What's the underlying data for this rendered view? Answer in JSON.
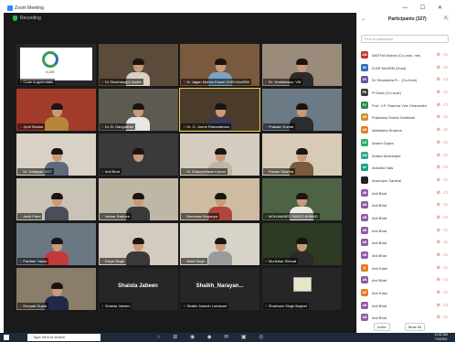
{
  "window": {
    "title": "Zoom Meeting",
    "controls": "— ☐ ✕"
  },
  "meeting": {
    "label": "Recording",
    "view_label": "Speaker View"
  },
  "tiles": [
    {
      "name": "Code Augmentatio",
      "kind": "logo",
      "logo_text": "ICAR"
    },
    {
      "name": "Dr Shubhangini Jantre",
      "kind": "person",
      "bg": "#5b4b3a",
      "shirt": "#d7d0c4"
    },
    {
      "name": "Dr Jagan Mohan Kosuri ICAR-NAARM",
      "kind": "person",
      "bg": "#7a5a3e",
      "shirt": "#7aa4c8"
    },
    {
      "name": "Dr. Venkatesan, VM",
      "kind": "person",
      "bg": "#9a8b7a",
      "shirt": "#2a2a2a"
    },
    {
      "name": "Jyoti Sankar",
      "kind": "person",
      "bg": "#a33b2b",
      "shirt": "#b7863b"
    },
    {
      "name": "Dr. B. Gangadhar",
      "kind": "person",
      "bg": "#5e5a52",
      "shirt": "#e6e6e6"
    },
    {
      "name": "Dr. G. Jonne Ramaratnam",
      "kind": "person",
      "bg": "#4b3b2a",
      "shirt": "#3a3a55",
      "highlight": true
    },
    {
      "name": "Prakash Kumar",
      "kind": "person",
      "bg": "#6c7a86",
      "shirt": "#2c2c2c"
    },
    {
      "name": "Dr. Dattayak VGT",
      "kind": "person",
      "bg": "#d8d2c6",
      "shirt": "#5b6b7a"
    },
    {
      "name": "Anil Bhat",
      "kind": "person",
      "bg": "#3a3a3a",
      "shirt": "#3a3a3a"
    },
    {
      "name": "Dr Dhanyeshwar Kumar",
      "kind": "person",
      "bg": "#d4cdbf",
      "shirt": "#bfb6a4"
    },
    {
      "name": "Pawan Sharma",
      "kind": "person",
      "bg": "#d7cbb8",
      "shirt": "#7b5a3d"
    },
    {
      "name": "Ankit Patel",
      "kind": "person",
      "bg": "#c9c3b6",
      "shirt": "#4a4e5a"
    },
    {
      "name": "Ishwar Rathore",
      "kind": "person",
      "bg": "#bfb7a6",
      "shirt": "#3a3a3a"
    },
    {
      "name": "Nimmala Soujanya",
      "kind": "person",
      "bg": "#cdbba2",
      "shirt": "#b0463f"
    },
    {
      "name": "MOHAMMED SAROJ AHMAD",
      "kind": "person",
      "bg": "#4e6246",
      "shirt": "#ece9e4"
    },
    {
      "name": "Parthan Yadav",
      "kind": "person",
      "bg": "#6b7884",
      "shirt": "#c33a3a"
    },
    {
      "name": "Divya Singh",
      "kind": "person",
      "bg": "#d4cbc0",
      "shirt": "#3a3a3a"
    },
    {
      "name": "Ankit Singh",
      "kind": "person",
      "bg": "#d8d3c8",
      "shirt": "#9a9a9a"
    },
    {
      "name": "Murlidhar Shirsat",
      "kind": "person",
      "bg": "#2f3a25",
      "shirt": "#2a2a2a"
    },
    {
      "name": "Deepak Gupta",
      "kind": "person",
      "bg": "#8a7d6a",
      "shirt": "#1f2a4a"
    },
    {
      "name": "Shaista Jabeen",
      "kind": "text",
      "big": "Shaista Jabeen"
    },
    {
      "name": "Shaikh Naresh Lohakare",
      "kind": "text",
      "big": "Shaikh_Narayan..."
    },
    {
      "name": "Shubham Singh Baghel",
      "kind": "image"
    }
  ],
  "participants": {
    "title": "Participants (327)",
    "search_placeholder": "Find a participant",
    "items": [
      {
        "initials": "AM",
        "name": "ANITHA Mohan (Co-host, me)",
        "color": "#c0392b"
      },
      {
        "initials": "IM",
        "name": "ICAR NAARM (Host)",
        "color": "#2d6fb7"
      },
      {
        "initials": "DS",
        "name": "Dr Srivastava R... (Co-host)",
        "color": "#6b4fa0"
      },
      {
        "initials": "PD",
        "name": "Pi Dash (Co-host)",
        "color": "#3a3a3a"
      },
      {
        "initials": "PJ",
        "name": "Prof. J.P. Sharma Vice Chancellor",
        "color": "#2c8a4a"
      },
      {
        "initials": "AS",
        "name": "Prakasha Sneha Gudibadi",
        "color": "#d09030"
      },
      {
        "initials": "AB",
        "name": "Abhilasha Sharma",
        "color": "#e67e22"
      },
      {
        "initials": "AG",
        "name": "Anand Gupta",
        "color": "#27ae60"
      },
      {
        "initials": "AM",
        "name": "Antara Mukherjee",
        "color": "#2ea58a"
      },
      {
        "initials": "AV",
        "name": "Anindita Vats",
        "color": "#16a085"
      },
      {
        "initials": "",
        "name": "Anandpur Sahibal",
        "color": "#222222"
      },
      {
        "initials": "AB",
        "name": "Anil Bhat",
        "color": "#8e5aa6"
      },
      {
        "initials": "AB",
        "name": "Anil Bhat",
        "color": "#8e5aa6"
      },
      {
        "initials": "AB",
        "name": "Anil Bhat",
        "color": "#8e5aa6"
      },
      {
        "initials": "AB",
        "name": "Anil Bhat",
        "color": "#8e5aa6"
      },
      {
        "initials": "AB",
        "name": "Anil Bhat",
        "color": "#8e5aa6"
      },
      {
        "initials": "AB",
        "name": "Anil Bhat",
        "color": "#8e5aa6"
      },
      {
        "initials": "A",
        "name": "Anil Kdan",
        "color": "#e67e22"
      },
      {
        "initials": "AB",
        "name": "Anil Bhat",
        "color": "#8e5aa6"
      },
      {
        "initials": "AK",
        "name": "Anil Kdan",
        "color": "#e67e22"
      },
      {
        "initials": "AB",
        "name": "Anil Bhat",
        "color": "#8e5aa6"
      },
      {
        "initials": "AB",
        "name": "Anil Bhat",
        "color": "#8e5aa6"
      }
    ],
    "invite_label": "Invite",
    "mute_all_label": "Mute All"
  },
  "taskbar": {
    "search_text": "Type here to search",
    "time": "11:02 AM",
    "date": "7/2/2021"
  }
}
